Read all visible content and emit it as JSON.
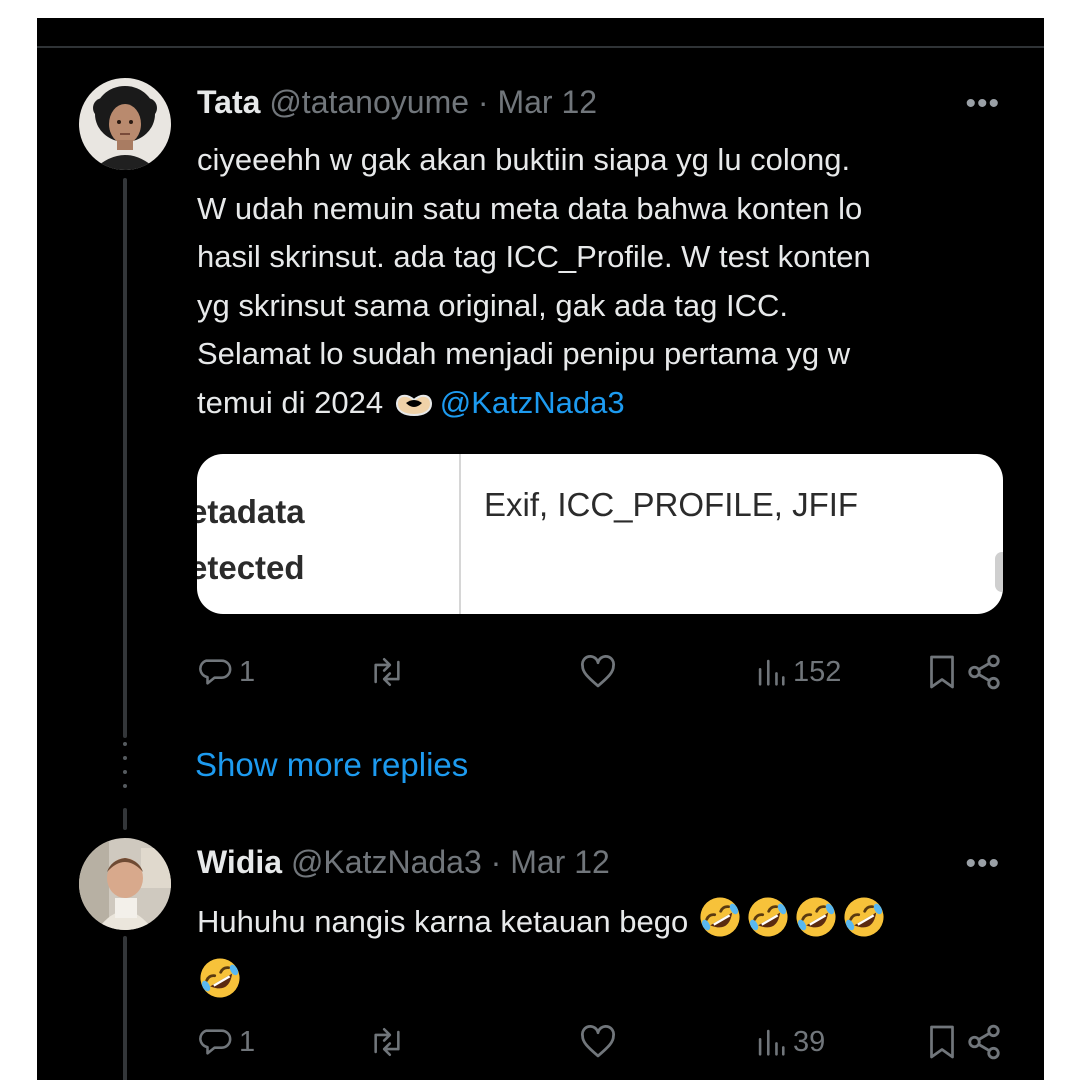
{
  "colors": {
    "background": "#000000",
    "text_primary": "#e7e9ea",
    "text_secondary": "#71767b",
    "link_blue": "#1d9bf0"
  },
  "tweets": [
    {
      "display_name": "Tata",
      "handle": "@tatanoyume",
      "date": "Mar 12",
      "more_label": "•••",
      "text_lines": [
        "ciyeeehh w gak akan buktiin siapa yg lu colong.",
        "W udah nemuin satu meta data bahwa konten lo",
        "hasil skrinsut. ada tag ICC_Profile. W test konten",
        "yg skrinsut sama original, gak ada tag ICC.",
        "Selamat lo sudah menjadi penipu pertama yg w",
        "temui di 2024"
      ],
      "mention": "@KatzNada3",
      "emoji": "heart-hands-emoji",
      "embed": {
        "label_line1": "etadata",
        "label_line2": "etected",
        "value": "Exif, ICC_PROFILE, JFIF"
      },
      "actions": {
        "replies": "1",
        "views": "152"
      }
    },
    {
      "display_name": "Widia",
      "handle": "@KatzNada3",
      "date": "Mar 12",
      "more_label": "•••",
      "text_lines": [
        "Huhuhu nangis karna ketauan bego"
      ],
      "emoji": "rolling-on-floor-laughing-emoji",
      "emoji_count": 5,
      "actions": {
        "replies": "1",
        "views": "39"
      }
    }
  ],
  "show_more_label": "Show more replies",
  "separator": "·"
}
